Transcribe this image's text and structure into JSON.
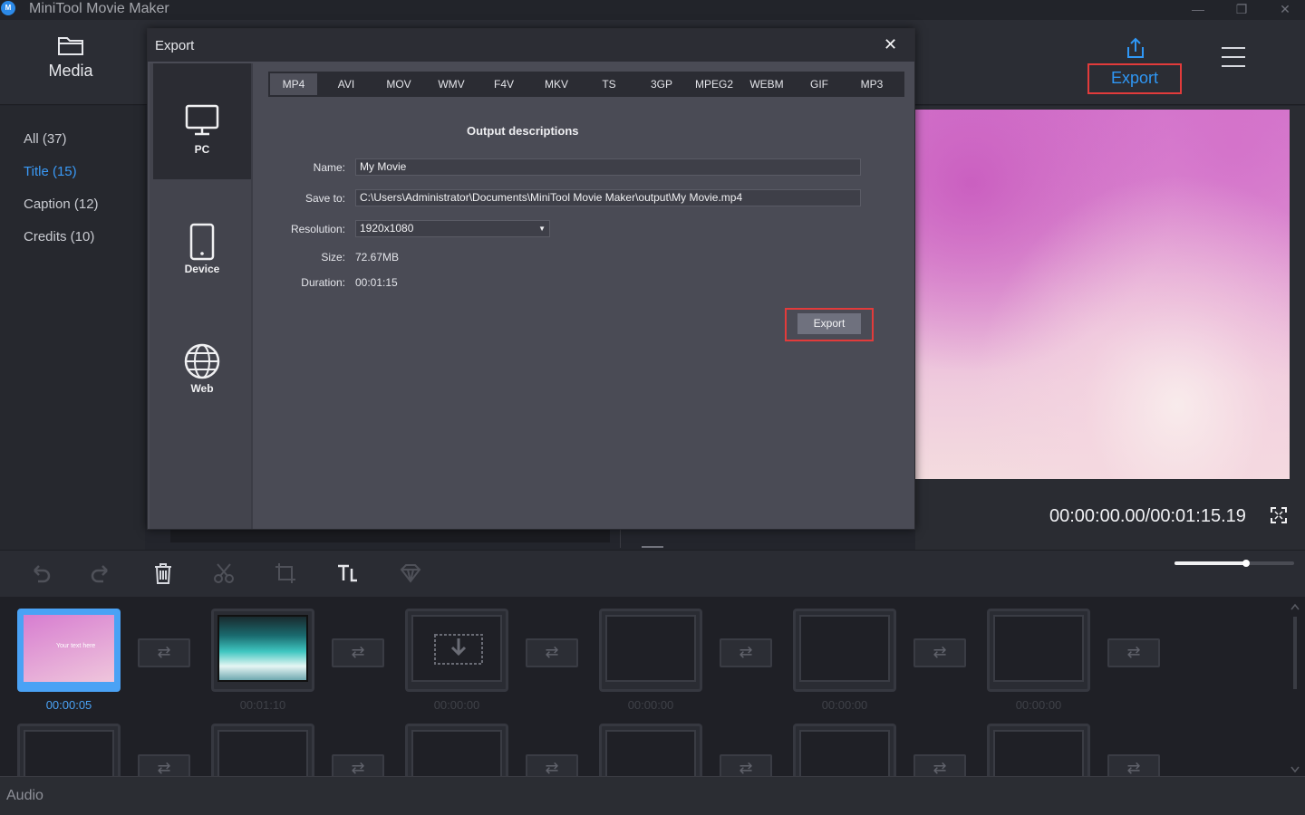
{
  "app": {
    "title": "MiniTool Movie Maker",
    "logo": "M"
  },
  "window_controls": {
    "minimize": "—",
    "maximize": "❐",
    "close": "✕"
  },
  "topbar": {
    "media_label": "Media",
    "export_label": "Export"
  },
  "library": {
    "items": [
      {
        "label": "All (37)",
        "active": false
      },
      {
        "label": "Title (15)",
        "active": true
      },
      {
        "label": "Caption (12)",
        "active": false
      },
      {
        "label": "Credits (10)",
        "active": false
      }
    ]
  },
  "preview": {
    "timecode": "00:00:00.00/00:01:15.19"
  },
  "zoom": {
    "level": 0.6
  },
  "timeline": {
    "clips_row1": [
      {
        "time": "00:00:05",
        "selected": true,
        "kind": "title",
        "thumb_text": "Your text here"
      },
      {
        "time": "00:01:10",
        "selected": false,
        "kind": "video"
      },
      {
        "time": "00:00:00",
        "selected": false,
        "kind": "drop"
      },
      {
        "time": "00:00:00",
        "selected": false,
        "kind": "empty"
      },
      {
        "time": "00:00:00",
        "selected": false,
        "kind": "empty"
      },
      {
        "time": "00:00:00",
        "selected": false,
        "kind": "empty"
      }
    ],
    "audio_label": "Audio"
  },
  "dialog": {
    "title": "Export",
    "close": "✕",
    "targets": [
      {
        "label": "PC",
        "active": true,
        "icon": "monitor-icon"
      },
      {
        "label": "Device",
        "active": false,
        "icon": "phone-icon"
      },
      {
        "label": "Web",
        "active": false,
        "icon": "globe-icon"
      }
    ],
    "formats": [
      "MP4",
      "AVI",
      "MOV",
      "WMV",
      "F4V",
      "MKV",
      "TS",
      "3GP",
      "MPEG2",
      "WEBM",
      "GIF",
      "MP3"
    ],
    "active_format": "MP4",
    "section_title": "Output descriptions",
    "fields": {
      "name_label": "Name:",
      "name_value": "My Movie",
      "save_label": "Save to:",
      "save_value": "C:\\Users\\Administrator\\Documents\\MiniTool Movie Maker\\output\\My Movie.mp4",
      "resolution_label": "Resolution:",
      "resolution_value": "1920x1080",
      "size_label": "Size:",
      "size_value": "72.67MB",
      "duration_label": "Duration:",
      "duration_value": "00:01:15"
    },
    "export_button": "Export"
  },
  "colors": {
    "accent": "#2f97f5",
    "highlight": "#e23b3b",
    "panel": "#4a4b55"
  }
}
